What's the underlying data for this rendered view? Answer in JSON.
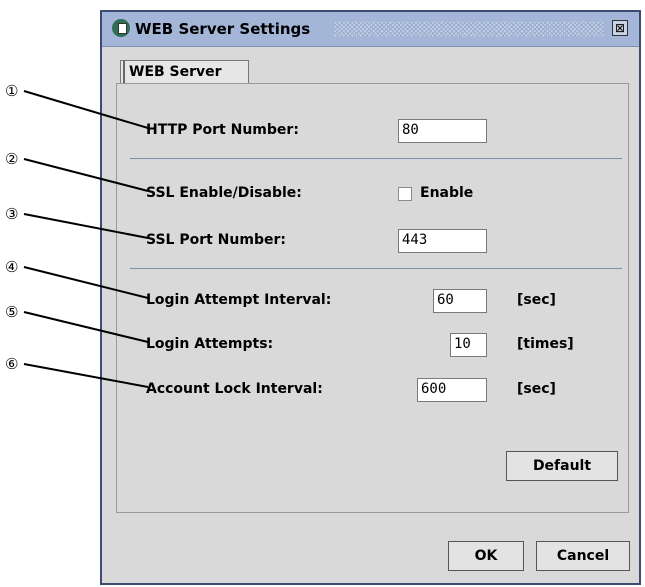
{
  "callouts": [
    "①",
    "②",
    "③",
    "④",
    "⑤",
    "⑥"
  ],
  "window": {
    "title": "WEB Server Settings",
    "close_glyph": "⊠"
  },
  "tab": {
    "label": "WEB Server"
  },
  "http_port": {
    "label": "HTTP Port Number:",
    "value": "80"
  },
  "ssl": {
    "label": "SSL Enable/Disable:",
    "checkbox_label": "Enable",
    "checked": false
  },
  "ssl_port": {
    "label": "SSL Port Number:",
    "value": "443"
  },
  "login_interval": {
    "label": "Login Attempt Interval:",
    "value": "60",
    "unit": "[sec]"
  },
  "login_attempts": {
    "label": "Login Attempts:",
    "value": "10",
    "unit": "[times]"
  },
  "lock_interval": {
    "label": "Account Lock Interval:",
    "value": "600",
    "unit": "[sec]"
  },
  "buttons": {
    "default": "Default",
    "ok": "OK",
    "cancel": "Cancel"
  }
}
